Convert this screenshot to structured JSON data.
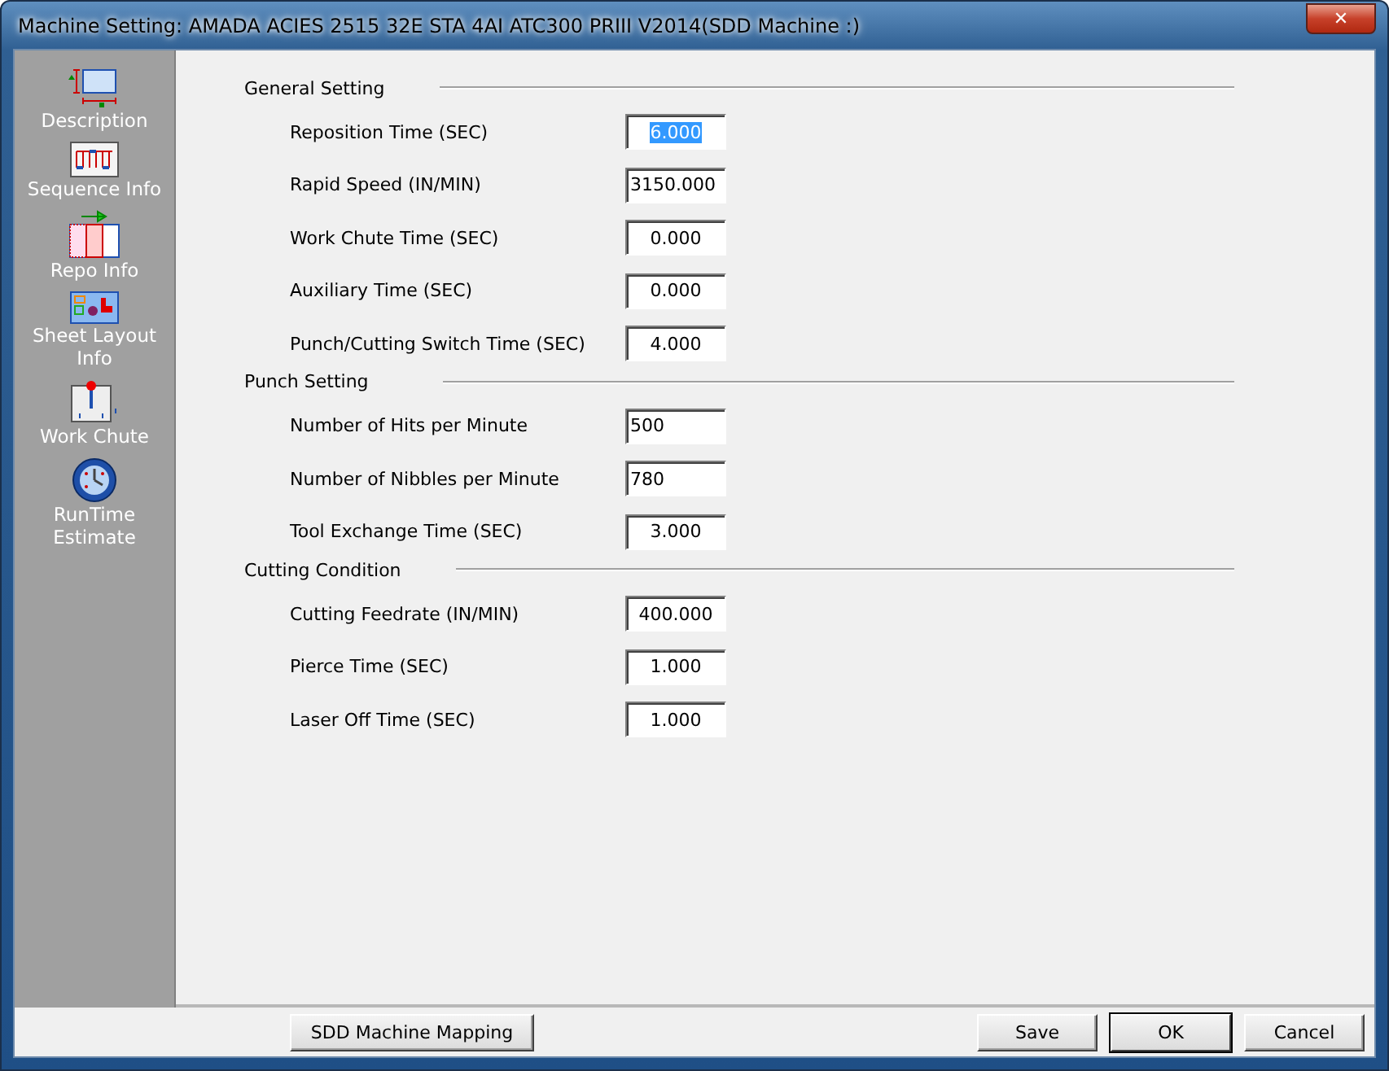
{
  "window": {
    "title": "Machine Setting:  AMADA ACIES 2515 32E STA 4AI ATC300 PRIII V2014(SDD Machine :)",
    "close": "✕"
  },
  "sidebar": {
    "items": [
      {
        "label": "Description",
        "kind": "description"
      },
      {
        "label": "Sequence Info",
        "kind": "sequence"
      },
      {
        "label": "Repo Info",
        "kind": "repo"
      },
      {
        "label": "Sheet Layout Info",
        "kind": "layout"
      },
      {
        "label": "Work Chute",
        "kind": "chute"
      },
      {
        "label": "RunTime Estimate",
        "kind": "clock"
      }
    ]
  },
  "sections": [
    {
      "title": "General Setting",
      "fields": [
        {
          "label": "Reposition Time (SEC)",
          "value": "6.000",
          "kind": "centered",
          "selected": true
        },
        {
          "label": "Rapid Speed (IN/MIN)",
          "value": "3150.000",
          "kind": "flush",
          "selected": false
        },
        {
          "label": "Work Chute Time (SEC)",
          "value": "0.000",
          "kind": "centered",
          "selected": false
        },
        {
          "label": "Auxiliary Time (SEC)",
          "value": "0.000",
          "kind": "centered",
          "selected": false
        },
        {
          "label": "Punch/Cutting Switch Time (SEC)",
          "value": "4.000",
          "kind": "centered",
          "selected": false
        }
      ]
    },
    {
      "title": "Punch Setting",
      "fields": [
        {
          "label": "Number of Hits per Minute",
          "value": "500",
          "kind": "flush",
          "selected": false
        },
        {
          "label": "Number of Nibbles per Minute",
          "value": "780",
          "kind": "flush",
          "selected": false
        },
        {
          "label": "Tool Exchange Time (SEC)",
          "value": "3.000",
          "kind": "centered",
          "selected": false
        }
      ]
    },
    {
      "title": "Cutting Condition",
      "fields": [
        {
          "label": "Cutting Feedrate (IN/MIN)",
          "value": "400.000",
          "kind": "centered",
          "selected": false
        },
        {
          "label": "Pierce Time (SEC)",
          "value": "1.000",
          "kind": "centered",
          "selected": false
        },
        {
          "label": "Laser Off Time (SEC)",
          "value": "1.000",
          "kind": "centered",
          "selected": false
        }
      ]
    }
  ],
  "mapping_button": "SDD Machine Mapping",
  "buttons": [
    {
      "label": "Save",
      "default": false
    },
    {
      "label": "OK",
      "default": true
    },
    {
      "label": "Cancel",
      "default": false
    }
  ]
}
